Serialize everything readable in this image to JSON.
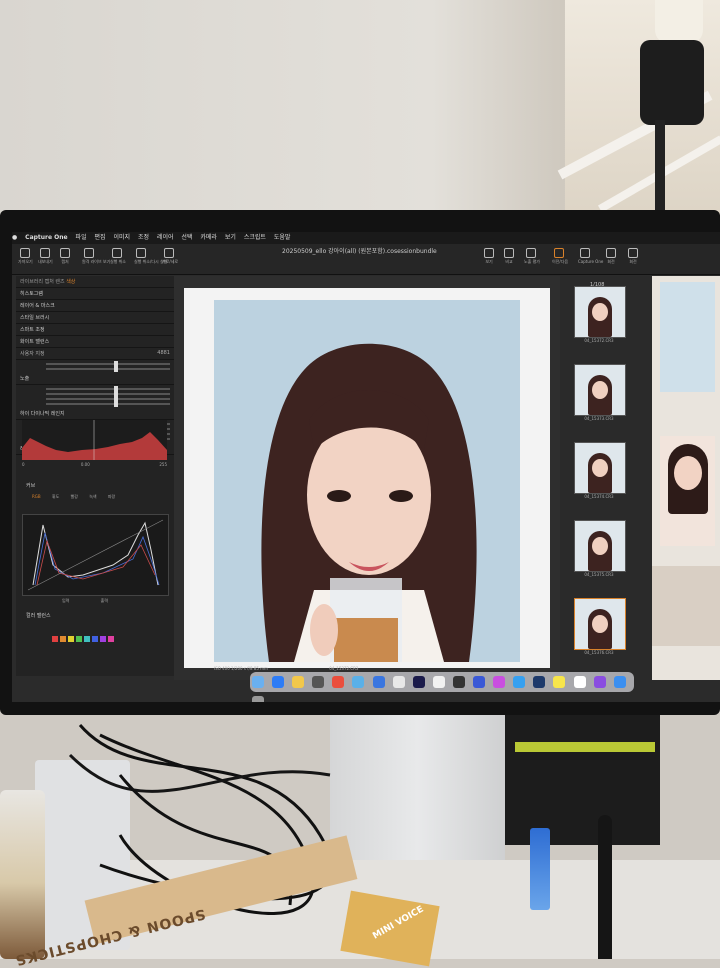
{
  "menubar": {
    "app_name": "Capture One",
    "items": [
      "파일",
      "편집",
      "이미지",
      "조정",
      "레이어",
      "선택",
      "카메라",
      "보기",
      "스크립트",
      "도움말"
    ],
    "window_title": "20250509_ello 강아이(all) (원본포함).cosessionbundle"
  },
  "toolbar": {
    "left_tools": [
      "가져오기",
      "내보내기",
      "캡처",
      "원격 라이브 보기",
      "실행 취소",
      "실행 취소/다시 실행",
      "가로/세로"
    ],
    "right_tools": [
      "보기",
      "비교",
      "노출 평가",
      "이전/다음",
      "Capture One",
      "회전",
      "회전"
    ]
  },
  "panel": {
    "tabs": [
      "라이브러리",
      "캡처",
      "렌즈",
      "색상",
      "노출",
      "디테일",
      "조정",
      "메타데이터"
    ],
    "sections": [
      "히스토그램",
      "레이어 & 마스크",
      "스타일 브러시",
      "스마트 조정",
      "화이트 밸런스",
      "노출",
      "하이 다이나믹 레인지",
      "레벨",
      "커브",
      "컬러 밸런스"
    ],
    "wb_mode": "사용자 지정",
    "wb_values": [
      "4881",
      "1.5"
    ],
    "curve_tabs": [
      "RGB",
      "휘도",
      "빨강",
      "녹색",
      "파랑"
    ],
    "curve_labels": [
      "입력",
      "출력"
    ],
    "levels_values": [
      "0",
      "0.00",
      "255"
    ]
  },
  "viewer": {
    "meta_left": "ISO 400  1/200 s  f/8  85 mm",
    "meta_right": "04_15372.CR3"
  },
  "filmstrip": {
    "count": "1/108",
    "items": [
      "04_15372.CR3",
      "04_15373.CR3",
      "04_15374.CR3",
      "04_15375.CR3",
      "04_15376.CR3"
    ]
  },
  "desk": {
    "chopsticks": "SPOON & CHOPSTICKS",
    "snack": "MINI VOICE"
  },
  "colors": {
    "accent": "#d9822b",
    "screen_bg": "#2b2b2b",
    "backdrop": "#bcd2e0",
    "hair": "#3d2320"
  }
}
